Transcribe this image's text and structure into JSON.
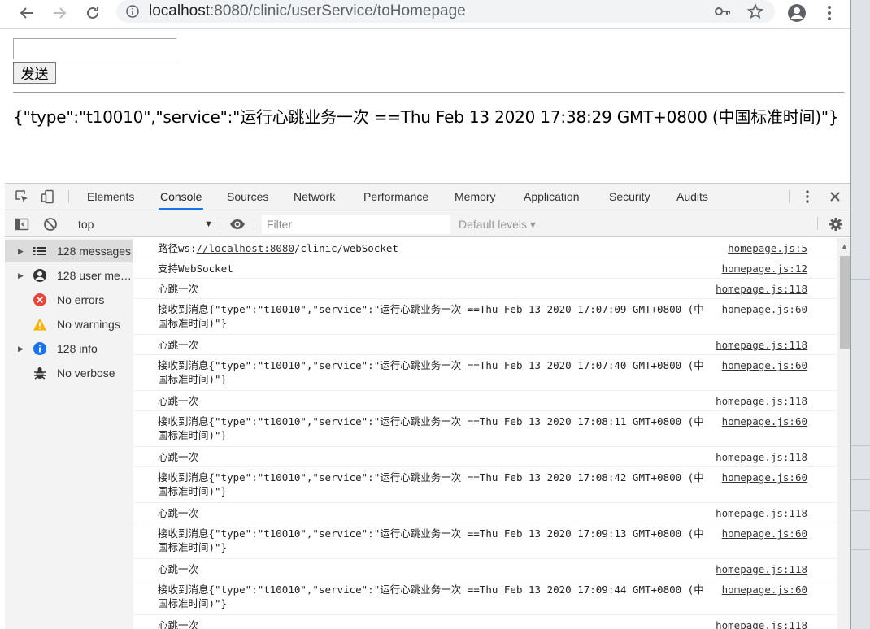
{
  "browser": {
    "url_host": "localhost",
    "url_path": ":8080/clinic/userService/toHomepage",
    "icons": [
      "back-arrow-icon",
      "forward-arrow-icon",
      "reload-icon",
      "info-icon",
      "key-icon",
      "star-icon",
      "account-icon",
      "more-vert-icon"
    ]
  },
  "page": {
    "input_value": "",
    "send_label": "发送",
    "response_text": "{\"type\":\"t10010\",\"service\":\"运行心跳业务一次 ==Thu Feb 13 2020 17:38:29 GMT+0800 (中国标准时间)\"}"
  },
  "devtools": {
    "tabs": [
      {
        "label": "Elements",
        "active": false
      },
      {
        "label": "Console",
        "active": true
      },
      {
        "label": "Sources",
        "active": false
      },
      {
        "label": "Network",
        "active": false
      },
      {
        "label": "Performance",
        "active": false
      },
      {
        "label": "Memory",
        "active": false
      },
      {
        "label": "Application",
        "active": false
      },
      {
        "label": "Security",
        "active": false
      },
      {
        "label": "Audits",
        "active": false
      }
    ],
    "context": "top",
    "filter_placeholder": "Filter",
    "levels_label": "Default levels ▾",
    "sidebar": [
      {
        "label": "128 messages",
        "icon": "list-icon",
        "expandable": true,
        "selected": true
      },
      {
        "label": "128 user messages",
        "icon": "user-icon",
        "expandable": true,
        "selected": false
      },
      {
        "label": "No errors",
        "icon": "error-icon",
        "expandable": false,
        "selected": false
      },
      {
        "label": "No warnings",
        "icon": "warning-icon",
        "expandable": false,
        "selected": false
      },
      {
        "label": "128 info",
        "icon": "info-icon",
        "expandable": true,
        "selected": false
      },
      {
        "label": "No verbose",
        "icon": "bug-icon",
        "expandable": false,
        "selected": false
      }
    ],
    "logs": [
      {
        "prefix": "路径ws:",
        "link": "//localhost:8080",
        "suffix": "/clinic/webSocket",
        "source": "homepage.js:5"
      },
      {
        "prefix": "支持WebSocket",
        "link": "",
        "suffix": "",
        "source": "homepage.js:12"
      },
      {
        "prefix": "心跳一次",
        "link": "",
        "suffix": "",
        "source": "homepage.js:118"
      },
      {
        "prefix": "接收到消息{\"type\":\"t10010\",\"service\":\"运行心跳业务一次 ==Thu Feb 13 2020 17:07:09 GMT+0800 (中国标准时间)\"}",
        "link": "",
        "suffix": "",
        "source": "homepage.js:60"
      },
      {
        "prefix": "心跳一次",
        "link": "",
        "suffix": "",
        "source": "homepage.js:118"
      },
      {
        "prefix": "接收到消息{\"type\":\"t10010\",\"service\":\"运行心跳业务一次 ==Thu Feb 13 2020 17:07:40 GMT+0800 (中国标准时间)\"}",
        "link": "",
        "suffix": "",
        "source": "homepage.js:60"
      },
      {
        "prefix": "心跳一次",
        "link": "",
        "suffix": "",
        "source": "homepage.js:118"
      },
      {
        "prefix": "接收到消息{\"type\":\"t10010\",\"service\":\"运行心跳业务一次 ==Thu Feb 13 2020 17:08:11 GMT+0800 (中国标准时间)\"}",
        "link": "",
        "suffix": "",
        "source": "homepage.js:60"
      },
      {
        "prefix": "心跳一次",
        "link": "",
        "suffix": "",
        "source": "homepage.js:118"
      },
      {
        "prefix": "接收到消息{\"type\":\"t10010\",\"service\":\"运行心跳业务一次 ==Thu Feb 13 2020 17:08:42 GMT+0800 (中国标准时间)\"}",
        "link": "",
        "suffix": "",
        "source": "homepage.js:60"
      },
      {
        "prefix": "心跳一次",
        "link": "",
        "suffix": "",
        "source": "homepage.js:118"
      },
      {
        "prefix": "接收到消息{\"type\":\"t10010\",\"service\":\"运行心跳业务一次 ==Thu Feb 13 2020 17:09:13 GMT+0800 (中国标准时间)\"}",
        "link": "",
        "suffix": "",
        "source": "homepage.js:60"
      },
      {
        "prefix": "心跳一次",
        "link": "",
        "suffix": "",
        "source": "homepage.js:118"
      },
      {
        "prefix": "接收到消息{\"type\":\"t10010\",\"service\":\"运行心跳业务一次 ==Thu Feb 13 2020 17:09:44 GMT+0800 (中国标准时间)\"}",
        "link": "",
        "suffix": "",
        "source": "homepage.js:60"
      },
      {
        "prefix": "心跳一次",
        "link": "",
        "suffix": "",
        "source": "homepage.js:118"
      }
    ]
  },
  "colors": {
    "accent": "#1a73e8",
    "error": "#e8453c",
    "warning": "#f4b400",
    "info": "#1a73e8"
  }
}
